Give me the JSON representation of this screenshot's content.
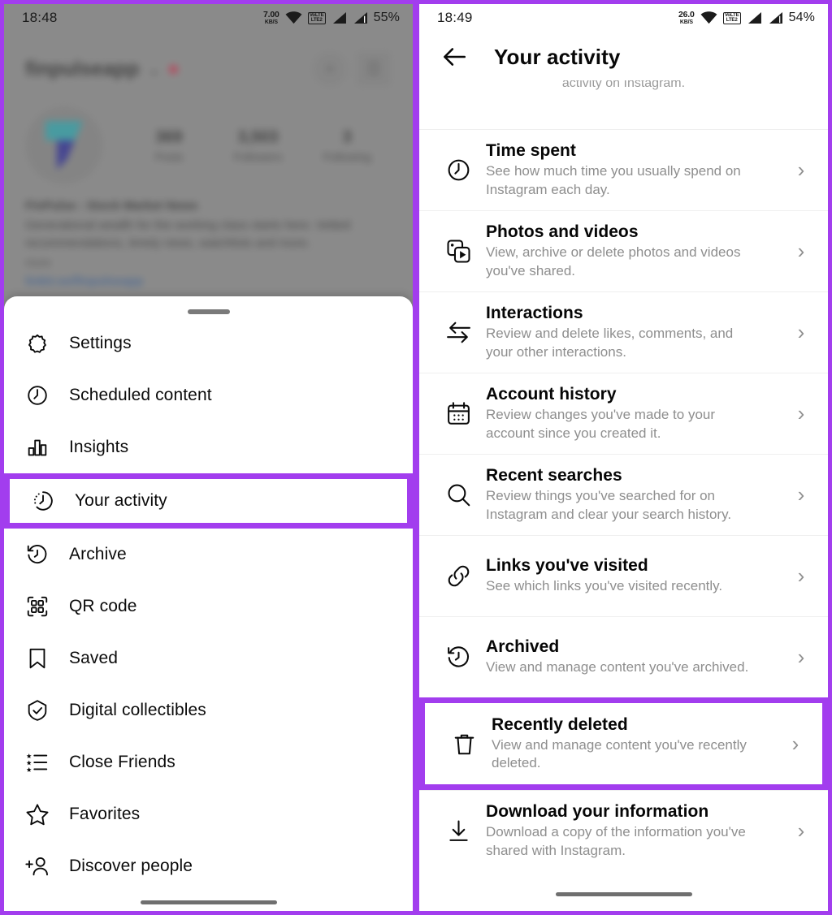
{
  "left": {
    "status": {
      "clock": "18:48",
      "net_speed": "7.00",
      "net_unit": "KB/S",
      "volte_top": "VoLTE",
      "volte_bottom": "LTE2",
      "battery": "55%"
    },
    "profile": {
      "username": "finpulseapp",
      "caret": "⌄",
      "posts_count": "369",
      "posts_label": "Posts",
      "followers_count": "3,503",
      "followers_label": "Followers",
      "following_count": "3",
      "following_label": "Following",
      "bio_title": "FinPulse : Stock Market News",
      "bio_line": "Generational wealth for the working class starts here. Vetted recommendations, timely news, watchlists and more.",
      "bio_more": "more",
      "bio_link": "linktr.ee/finpulseapp",
      "add_button": "+",
      "menu_button": "☰"
    },
    "sheet": {
      "items": [
        {
          "label": "Settings",
          "icon": "gear-icon",
          "highlighted": false
        },
        {
          "label": "Scheduled content",
          "icon": "clock-icon",
          "highlighted": false
        },
        {
          "label": "Insights",
          "icon": "bar-chart-icon",
          "highlighted": false
        },
        {
          "label": "Your activity",
          "icon": "activity-clock-icon",
          "highlighted": true
        },
        {
          "label": "Archive",
          "icon": "archive-clock-icon",
          "highlighted": false
        },
        {
          "label": "QR code",
          "icon": "qr-code-icon",
          "highlighted": false
        },
        {
          "label": "Saved",
          "icon": "bookmark-icon",
          "highlighted": false
        },
        {
          "label": "Digital collectibles",
          "icon": "shield-check-icon",
          "highlighted": false
        },
        {
          "label": "Close Friends",
          "icon": "close-friends-list-icon",
          "highlighted": false
        },
        {
          "label": "Favorites",
          "icon": "star-icon",
          "highlighted": false
        },
        {
          "label": "Discover people",
          "icon": "add-person-icon",
          "highlighted": false
        }
      ]
    }
  },
  "right": {
    "status": {
      "clock": "18:49",
      "net_speed": "26.0",
      "net_unit": "KB/S",
      "volte_top": "VoLTE",
      "volte_bottom": "LTE2",
      "battery": "54%"
    },
    "header": {
      "title": "Your activity",
      "back_icon": "back-arrow-icon",
      "scrolled_text": "activity on Instagram."
    },
    "items": [
      {
        "title": "Time spent",
        "subtitle": "See how much time you usually spend on Instagram each day.",
        "icon": "clock-icon",
        "highlighted": false
      },
      {
        "title": "Photos and videos",
        "subtitle": "View, archive or delete photos and videos you've shared.",
        "icon": "photos-videos-icon",
        "highlighted": false
      },
      {
        "title": "Interactions",
        "subtitle": "Review and delete likes, comments, and your other interactions.",
        "icon": "interactions-arrows-icon",
        "highlighted": false
      },
      {
        "title": "Account history",
        "subtitle": "Review changes you've made to your account since you created it.",
        "icon": "calendar-icon",
        "highlighted": false
      },
      {
        "title": "Recent searches",
        "subtitle": "Review things you've searched for on Instagram and clear your search history.",
        "icon": "search-icon",
        "highlighted": false
      },
      {
        "title": "Links you've visited",
        "subtitle": "See which links you've visited recently.",
        "icon": "link-icon",
        "highlighted": false
      },
      {
        "title": "Archived",
        "subtitle": "View and manage content you've archived.",
        "icon": "archive-clock-icon",
        "highlighted": false
      },
      {
        "title": "Recently deleted",
        "subtitle": "View and manage content you've recently deleted.",
        "icon": "trash-icon",
        "highlighted": true
      },
      {
        "title": "Download your information",
        "subtitle": "Download a copy of the information you've shared with Instagram.",
        "icon": "download-icon",
        "highlighted": false
      }
    ],
    "chevron": "›"
  },
  "colors": {
    "highlight_purple": "#a23dee",
    "text_primary": "#060606",
    "text_secondary": "#8e8e8e"
  }
}
